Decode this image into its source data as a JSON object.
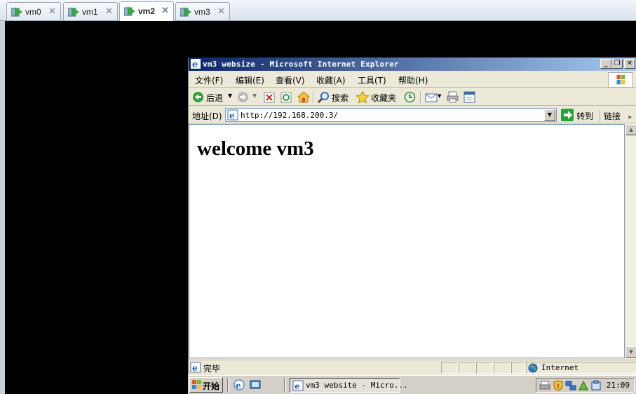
{
  "vm_tabs": [
    {
      "label": "vm0",
      "active": false
    },
    {
      "label": "vm1",
      "active": false
    },
    {
      "label": "vm2",
      "active": true
    },
    {
      "label": "vm3",
      "active": false
    }
  ],
  "ie": {
    "title": "vm3 websize - Microsoft Internet Explorer",
    "menu": [
      "文件(F)",
      "编辑(E)",
      "查看(V)",
      "收藏(A)",
      "工具(T)",
      "帮助(H)"
    ],
    "toolbar": {
      "back": "后退",
      "search": "搜索",
      "favorites": "收藏夹"
    },
    "address": {
      "label": "地址(D)",
      "url": "http://192.168.200.3/",
      "go": "转到",
      "links": "链接"
    },
    "page_heading": "welcome vm3",
    "status": {
      "text": "完毕",
      "zone": "Internet"
    }
  },
  "taskbar": {
    "start": "开始",
    "task_label": "vm3 website - Micro...",
    "clock": "21:09"
  },
  "colors": {
    "title_start": "#0a246a",
    "title_end": "#a6caf0",
    "console_bg": "#000000"
  }
}
